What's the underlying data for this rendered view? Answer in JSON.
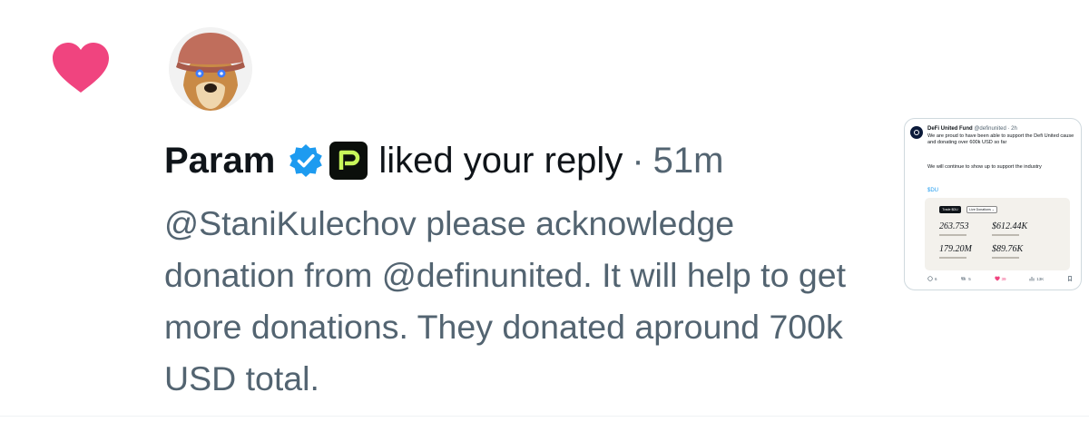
{
  "notification": {
    "user_name": "Param",
    "action_text": "liked your reply",
    "separator": "·",
    "time_ago": "51m",
    "reply_text": "@StaniKulechov please acknowledge donation from @definunited. It will help to get more donations. They donated apround 700k USD total."
  },
  "thumbnail": {
    "author_name": "DeFi United Fund",
    "author_handle": "@definunited · 2h",
    "text_1": "We are proud to have been able to support the Defi United cause and donating over 600k USD so far",
    "text_2": "We will continue to show up to support the industry",
    "tag": "$DU",
    "button_trade": "Trade $DU",
    "button_live": "Live Donations ⌄",
    "stat_1": "263.753",
    "stat_2": "$612.44K",
    "stat_3": "179.20M",
    "stat_4": "$89.76K",
    "replies": "6",
    "reposts": "5",
    "likes": "39",
    "views": "13K"
  },
  "colors": {
    "heart": "#f0447f",
    "verified": "#1d9bf0",
    "muted_text": "#536471",
    "primary_text": "#0f1419",
    "badge_accent": "#c8f65a"
  },
  "icons": [
    "heart-icon",
    "verified-badge-icon",
    "p-badge-icon",
    "reply-icon",
    "repost-icon",
    "like-icon",
    "views-icon",
    "bookmark-icon"
  ]
}
